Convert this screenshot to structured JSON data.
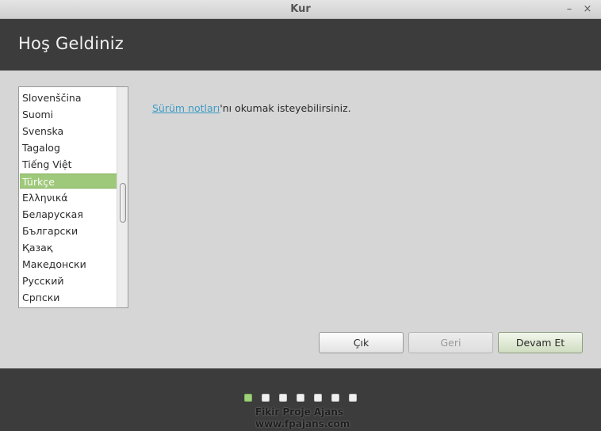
{
  "window": {
    "title": "Kur",
    "minimize_glyph": "–",
    "close_glyph": "×"
  },
  "header": {
    "title": "Hoş Geldiniz"
  },
  "languages": [
    "Slovenščina",
    "Suomi",
    "Svenska",
    "Tagalog",
    "Tiếng Việt",
    "Türkçe",
    "Ελληνικά",
    "Беларуская",
    "Български",
    "Қазақ",
    "Македонски",
    "Русский",
    "Српски"
  ],
  "selected_language": "Türkçe",
  "release_notes": {
    "link_text": "Sürüm notları",
    "suffix": "'nı okumak isteyebilirsiniz."
  },
  "buttons": {
    "quit": "Çık",
    "back": "Geri",
    "next": "Devam Et"
  },
  "progress": {
    "total_steps": 7,
    "current_step": 1
  },
  "watermark": {
    "line1": "Fikir Proje Ajans",
    "line2": "www.fpajans.com"
  },
  "colors": {
    "accent": "#9fc97a",
    "header_bg": "#3c3c3c",
    "link": "#3e9bc6"
  }
}
